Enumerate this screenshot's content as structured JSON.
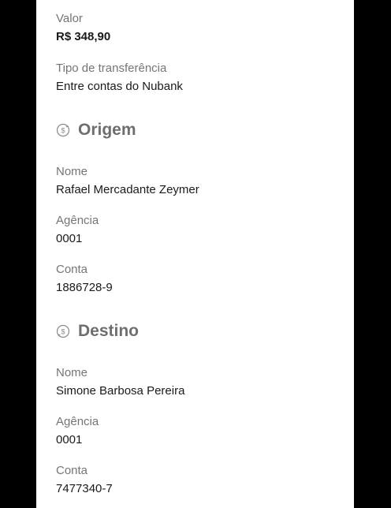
{
  "summary": {
    "valor_label": "Valor",
    "valor_value": "R$ 348,90",
    "tipo_label": "Tipo de transferência",
    "tipo_value": "Entre contas do Nubank"
  },
  "origem": {
    "title": "Origem",
    "icon": "money-transfer-icon",
    "nome_label": "Nome",
    "nome_value": "Rafael Mercadante Zeymer",
    "agencia_label": "Agência",
    "agencia_value": "0001",
    "conta_label": "Conta",
    "conta_value": "1886728-9"
  },
  "destino": {
    "title": "Destino",
    "icon": "money-transfer-icon",
    "nome_label": "Nome",
    "nome_value": "Simone Barbosa Pereira",
    "agencia_label": "Agência",
    "agencia_value": "0001",
    "conta_label": "Conta",
    "conta_value": "7477340-7"
  }
}
